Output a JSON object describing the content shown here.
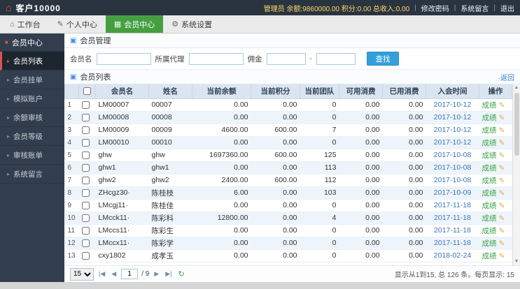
{
  "icons": {
    "logo": "⌂",
    "home": "⌂",
    "user": "✎",
    "members": "▦",
    "gear": "⚙",
    "panel": "▣",
    "arrow": "▸",
    "bullet": "■",
    "pencil": "✎",
    "first": "|◀",
    "prev": "◀",
    "next": "▶",
    "last": "▶|",
    "refresh": "↻",
    "scroll_up": "▲",
    "scroll_down": "▼"
  },
  "topbar": {
    "title": "客户10000",
    "stats": "管理员 余额:9860000.00 积分:0.00 总收入:0.00",
    "sep": "|",
    "links": {
      "change_password": "修改密码",
      "system_message": "系统留言",
      "logout": "退出"
    }
  },
  "tabs": {
    "workbench": "工作台",
    "personal": "个人中心",
    "members": "会员中心",
    "settings": "系统设置"
  },
  "sidebar": {
    "header": "会员中心",
    "items": [
      {
        "label": "会员列表"
      },
      {
        "label": "会员挂单"
      },
      {
        "label": "模拟账户"
      },
      {
        "label": "余额审核"
      },
      {
        "label": "会员等级"
      },
      {
        "label": "审核账单"
      },
      {
        "label": "系统留言"
      }
    ]
  },
  "panel": {
    "manage_title": "会员管理",
    "list_title": "会员列表",
    "back_link": "·返回"
  },
  "search": {
    "member_label": "会员名",
    "agent_label": "所属代理",
    "commission_label": "佣金",
    "range_sep": "-",
    "button": "查找"
  },
  "table": {
    "headers": [
      "会员名",
      "姓名",
      "当前余额",
      "当前积分",
      "当前团队",
      "可用消费",
      "已用消费",
      "入会时间",
      "操作"
    ],
    "op_label": "成绩",
    "rows": [
      {
        "n": "1",
        "id": "LM00007",
        "name": "00007",
        "balance": "0.00",
        "points": "0.00",
        "team": "0",
        "avail": "0.00",
        "used": "0.00",
        "date": "2017-10-12"
      },
      {
        "n": "2",
        "id": "LM00008",
        "name": "00008",
        "balance": "0.00",
        "points": "0.00",
        "team": "0",
        "avail": "0.00",
        "used": "0.00",
        "date": "2017-10-12"
      },
      {
        "n": "3",
        "id": "LM00009",
        "name": "00009",
        "balance": "4600.00",
        "points": "600.00",
        "team": "7",
        "avail": "0.00",
        "used": "0.00",
        "date": "2017-10-12"
      },
      {
        "n": "4",
        "id": "LM00010",
        "name": "00010",
        "balance": "0.00",
        "points": "0.00",
        "team": "0",
        "avail": "0.00",
        "used": "0.00",
        "date": "2017-10-12"
      },
      {
        "n": "5",
        "id": "ghw",
        "name": "ghw",
        "balance": "1697360.00",
        "points": "600.00",
        "team": "125",
        "avail": "0.00",
        "used": "0.00",
        "date": "2017-10-08"
      },
      {
        "n": "6",
        "id": "ghw1",
        "name": "ghw1",
        "balance": "0.00",
        "points": "0.00",
        "team": "113",
        "avail": "0.00",
        "used": "0.00",
        "date": "2017-10-08"
      },
      {
        "n": "7",
        "id": "ghw2",
        "name": "ghw2",
        "balance": "2400.00",
        "points": "600.00",
        "team": "112",
        "avail": "0.00",
        "used": "0.00",
        "date": "2017-10-08"
      },
      {
        "n": "8",
        "id": "ZHcgz30·",
        "name": "陈桂枝",
        "balance": "6.00",
        "points": "0.00",
        "team": "103",
        "avail": "0.00",
        "used": "0.00",
        "date": "2017-10-09"
      },
      {
        "n": "9",
        "id": "LMcgj11·",
        "name": "陈桂佳",
        "balance": "0.00",
        "points": "0.00",
        "team": "0",
        "avail": "0.00",
        "used": "0.00",
        "date": "2017-11-18"
      },
      {
        "n": "10",
        "id": "LMcck11·",
        "name": "陈彩科",
        "balance": "12800.00",
        "points": "0.00",
        "team": "4",
        "avail": "0.00",
        "used": "0.00",
        "date": "2017-11-18"
      },
      {
        "n": "11",
        "id": "LMccs11·",
        "name": "陈彩生",
        "balance": "0.00",
        "points": "0.00",
        "team": "0",
        "avail": "0.00",
        "used": "0.00",
        "date": "2017-11-18"
      },
      {
        "n": "12",
        "id": "LMccx11·",
        "name": "陈彩学",
        "balance": "0.00",
        "points": "0.00",
        "team": "0",
        "avail": "0.00",
        "used": "0.00",
        "date": "2017-11-18"
      },
      {
        "n": "13",
        "id": "cxy1802",
        "name": "成孝玉",
        "balance": "0.00",
        "points": "0.00",
        "team": "0",
        "avail": "0.00",
        "used": "0.00",
        "date": "2018-02-24"
      }
    ]
  },
  "pager": {
    "page_size": "15",
    "page": "1",
    "total_pages": "/ 9",
    "summary": "显示从1到15, 总 126 条。每页显示: 15"
  }
}
